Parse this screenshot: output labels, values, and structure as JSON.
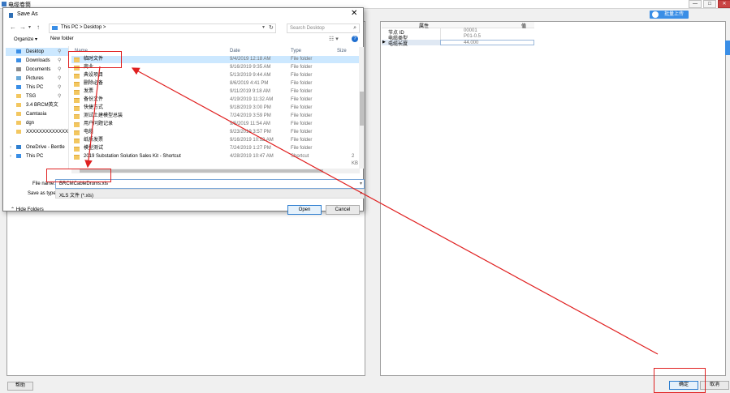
{
  "app": {
    "title": "电缆卷筒",
    "minimize": "—",
    "maximize": "□",
    "close": "✕",
    "upload_label": "批量上传",
    "help_button": "帮助",
    "ok_button": "确定",
    "cancel_button": "取消"
  },
  "property_grid": {
    "header_attr": "属性",
    "header_value": "值",
    "rows": [
      {
        "name": "节点 ID",
        "value": "00001"
      },
      {
        "name": "电缆类型",
        "value": "P01-0.5"
      },
      {
        "name": "电缆长度",
        "value": "44.000",
        "selected": true
      }
    ]
  },
  "dialog": {
    "title": "Save As",
    "close": "✕",
    "address_path": "This PC  >  Desktop  >",
    "search_placeholder": "Search Desktop",
    "organize": "Organize ▾",
    "new_folder": "New folder",
    "nav_items": [
      {
        "label": "Desktop",
        "icon": "desktop-icon",
        "pinned": true,
        "selected": true,
        "color": "#3a8ee6"
      },
      {
        "label": "Downloads",
        "icon": "download-icon",
        "pinned": true,
        "color": "#3a8ee6"
      },
      {
        "label": "Documents",
        "icon": "documents-icon",
        "pinned": true,
        "color": "#8c8c8c"
      },
      {
        "label": "Pictures",
        "icon": "pictures-icon",
        "pinned": true,
        "color": "#6aa9d8"
      },
      {
        "label": "This PC",
        "icon": "computer-icon",
        "pinned": true,
        "color": "#3a8ee6"
      },
      {
        "label": "TSG",
        "icon": "folder-icon",
        "pinned": true,
        "color": "#f3c760"
      },
      {
        "label": "3.4 BRCM英文",
        "icon": "folder-icon",
        "color": "#f3c760"
      },
      {
        "label": "Camtasia",
        "icon": "folder-icon",
        "color": "#f3c760"
      },
      {
        "label": "dgn",
        "icon": "folder-icon",
        "color": "#f3c760"
      },
      {
        "label": "XXXXXXXXXXXXX",
        "icon": "folder-icon",
        "color": "#f3c760"
      },
      {
        "label": "OneDrive - Bentle",
        "icon": "onedrive-icon",
        "expandable": true,
        "color": "#2f7fd0"
      },
      {
        "label": "This PC",
        "icon": "computer-icon",
        "expandable": true,
        "color": "#3a8ee6"
      }
    ],
    "columns": {
      "name": "Name",
      "date": "Date",
      "type": "Type",
      "size": "Size"
    },
    "files": [
      {
        "name": "临时文件",
        "date": "9/4/2019 12:18 AM",
        "type": "File folder",
        "size": "",
        "selected": true
      },
      {
        "name": "商业",
        "date": "9/16/2019 9:35 AM",
        "type": "File folder",
        "size": ""
      },
      {
        "name": "典设项目",
        "date": "5/13/2019 9:44 AM",
        "type": "File folder",
        "size": ""
      },
      {
        "name": "删除必备",
        "date": "8/6/2019 4:41 PM",
        "type": "File folder",
        "size": ""
      },
      {
        "name": "发票",
        "date": "9/11/2019 9:18 AM",
        "type": "File folder",
        "size": ""
      },
      {
        "name": "备份文件",
        "date": "4/19/2019 11:32 AM",
        "type": "File folder",
        "size": ""
      },
      {
        "name": "快捷方式",
        "date": "9/18/2019 3:00 PM",
        "type": "File folder",
        "size": ""
      },
      {
        "name": "测试土建模型总装",
        "date": "7/24/2019 3:59 PM",
        "type": "File folder",
        "size": ""
      },
      {
        "name": "用户问题记录",
        "date": "9/5/2019 11:54 AM",
        "type": "File folder",
        "size": ""
      },
      {
        "name": "电缆",
        "date": "9/23/2019 3:57 PM",
        "type": "File folder",
        "size": ""
      },
      {
        "name": "纸质发票",
        "date": "9/16/2019 10:52 AM",
        "type": "File folder",
        "size": ""
      },
      {
        "name": "模型测试",
        "date": "7/24/2019 1:27 PM",
        "type": "File folder",
        "size": ""
      },
      {
        "name": "2019 Substation Solution Sales Kit - Shortcut",
        "date": "4/28/2019 10:47 AM",
        "type": "Shortcut",
        "size": "2 KB"
      }
    ],
    "file_name_label": "File name:",
    "file_name_value": "BRCMCableDrums.xls",
    "save_type_label": "Save as type:",
    "save_type_value": "XLS 文件 (*.xls)",
    "hide_folders": "Hide Folders",
    "open_button": "Open",
    "cancel_button": "Cancel"
  },
  "annotation_color": "#e02020"
}
